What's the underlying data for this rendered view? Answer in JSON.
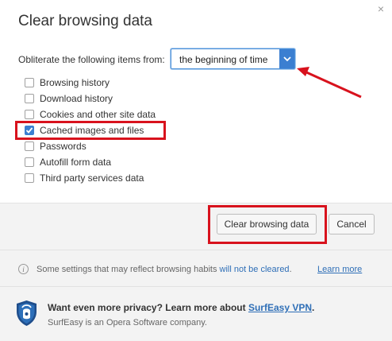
{
  "dialog": {
    "title": "Clear browsing data",
    "close_glyph": "×"
  },
  "obliterate": {
    "label": "Obliterate the following items from:",
    "selected": "the beginning of time"
  },
  "items": [
    {
      "label": "Browsing history",
      "checked": false
    },
    {
      "label": "Download history",
      "checked": false
    },
    {
      "label": "Cookies and other site data",
      "checked": false
    },
    {
      "label": "Cached images and files",
      "checked": true
    },
    {
      "label": "Passwords",
      "checked": false
    },
    {
      "label": "Autofill form data",
      "checked": false
    },
    {
      "label": "Third party services data",
      "checked": false
    }
  ],
  "buttons": {
    "clear": "Clear browsing data",
    "cancel": "Cancel"
  },
  "info": {
    "text_before": "Some settings that may reflect browsing habits ",
    "text_highlight": "will not be cleared",
    "text_after": ".",
    "link": "Learn more"
  },
  "promo": {
    "text": "Want even more privacy? Learn more about ",
    "link": "SurfEasy VPN",
    "text_end": ".",
    "sub": "SurfEasy is an Opera Software company."
  },
  "colors": {
    "accent": "#3b7fd1",
    "annotation_red": "#d8121d",
    "link": "#2f6fb7"
  },
  "icons": {
    "close": "close-icon",
    "dropdown": "chevron-down-icon",
    "info": "info-icon",
    "shield": "surfeasy-shield-icon"
  }
}
